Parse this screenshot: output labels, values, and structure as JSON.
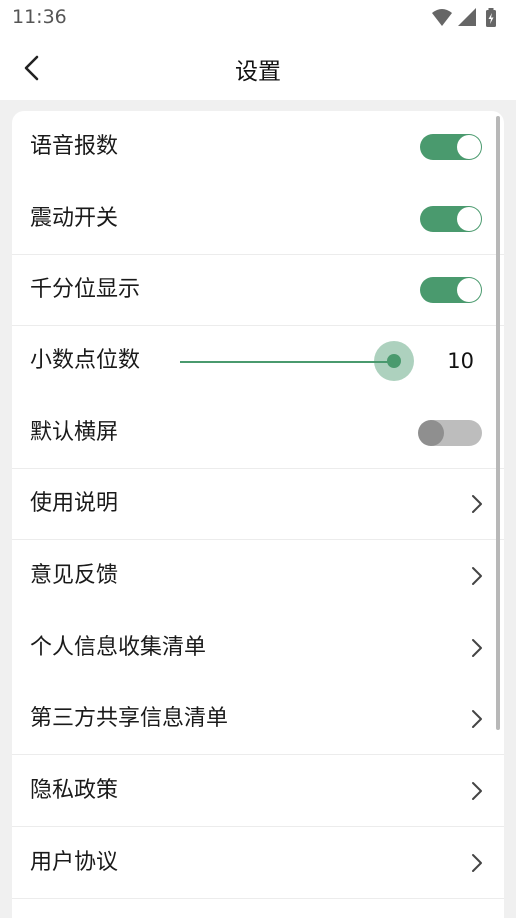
{
  "status_bar": {
    "time": "11:36",
    "icons": [
      "wifi-icon",
      "cellular-signal-icon",
      "battery-charging-icon"
    ]
  },
  "header": {
    "title": "设置",
    "back_icon": "chevron-left-icon"
  },
  "settings": {
    "voice_report": {
      "label": "语音报数",
      "enabled": true
    },
    "vibration": {
      "label": "震动开关",
      "enabled": true
    },
    "thousands_separator": {
      "label": "千分位显示",
      "enabled": true
    },
    "decimal_places": {
      "label": "小数点位数",
      "value": "10"
    },
    "default_landscape": {
      "label": "默认横屏",
      "enabled": false
    }
  },
  "links": {
    "instructions": "使用说明",
    "feedback": "意见反馈",
    "personal_info_list": "个人信息收集清单",
    "third_party_sharing": "第三方共享信息清单",
    "privacy_policy": "隐私政策",
    "user_agreement": "用户协议"
  },
  "colors": {
    "accent": "#4a9a6e",
    "toggle_off": "#bdbdbd",
    "background": "#f0f0f0"
  }
}
